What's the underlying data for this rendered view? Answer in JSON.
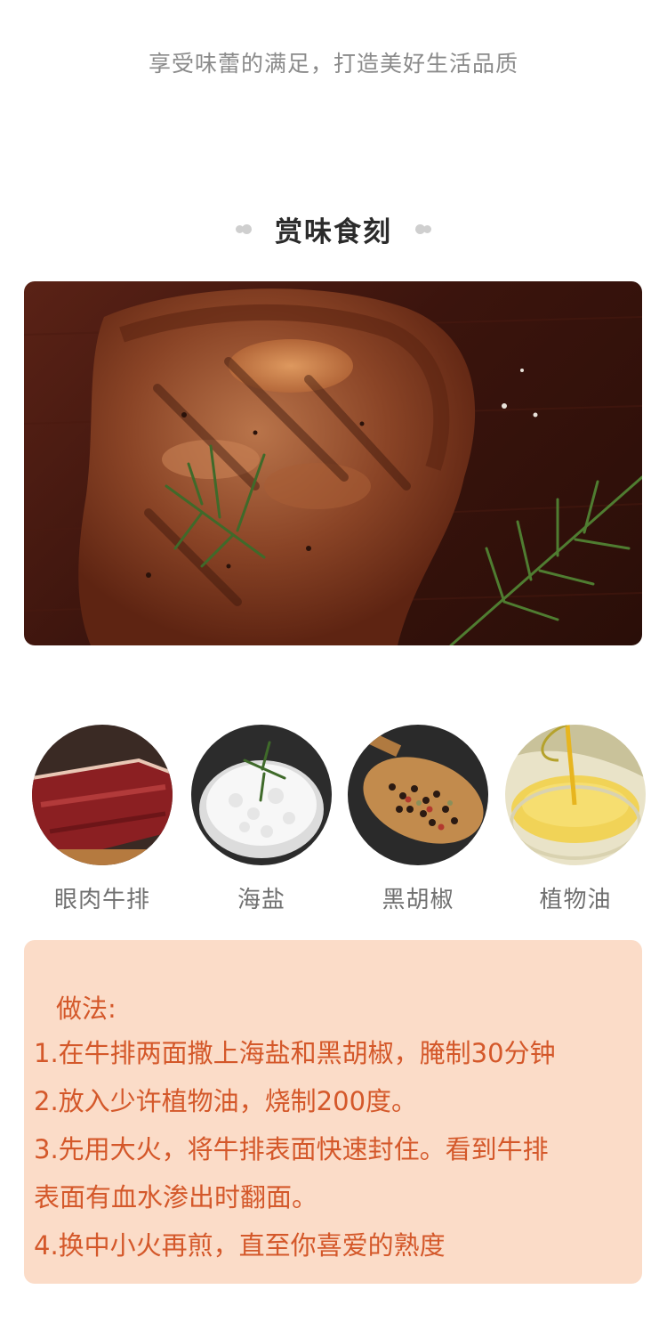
{
  "header": {
    "subtitle": "享受味蕾的满足，打造美好生活品质",
    "section_title": "赏味食刻"
  },
  "hero": {
    "icon": "steak-photo"
  },
  "ingredients": [
    {
      "label": "眼肉牛排",
      "icon": "beef-photo"
    },
    {
      "label": "海盐",
      "icon": "sea-salt-photo"
    },
    {
      "label": "黑胡椒",
      "icon": "black-pepper-photo"
    },
    {
      "label": "植物油",
      "icon": "vegetable-oil-photo"
    }
  ],
  "recipe": {
    "title": "做法:",
    "steps": [
      "1.在牛排两面撒上海盐和黑胡椒，腌制30分钟",
      "2.放入少许植物油，烧制200度。",
      "3.先用大火，将牛排表面快速封住。看到牛排",
      "表面有血水渗出时翻面。",
      "4.换中小火再煎，直至你喜爱的熟度"
    ]
  },
  "colors": {
    "accent": "#d4582a",
    "recipe_bg": "#fbdcc8",
    "subtitle_text": "#8a8a8a"
  }
}
